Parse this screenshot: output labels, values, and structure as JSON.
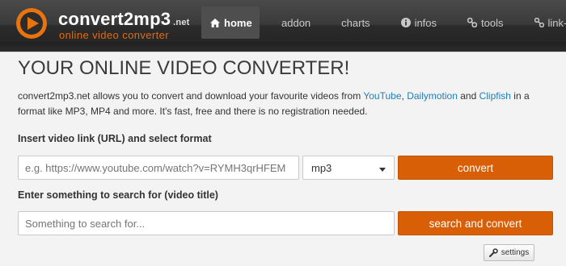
{
  "header": {
    "brand": "convert2mp3",
    "brand_suffix": ".net",
    "tagline": "online video converter",
    "nav": [
      {
        "label": "home",
        "icon": "home-icon"
      },
      {
        "label": "addon"
      },
      {
        "label": "charts"
      },
      {
        "label": "infos",
        "icon": "info-icon"
      },
      {
        "label": "tools",
        "icon": "tools-icon"
      },
      {
        "label": "link-us",
        "icon": "link-icon"
      }
    ]
  },
  "main": {
    "title": "YOUR ONLINE VIDEO CONVERTER!",
    "intro": {
      "text1": "convert2mp3.net allows you to convert and download your favourite videos from ",
      "link1": "YouTube",
      "sep1": ", ",
      "link2": "Dailymotion",
      "sep2": " and ",
      "link3": "Clipfish",
      "text2": " in a format like MP3, MP4 and more. It's fast, free and there is no registration needed."
    },
    "url_label": "Insert video link (URL) and select format",
    "url_placeholder": "e.g. https://www.youtube.com/watch?v=RYMH3qrHFEM",
    "format_selected": "mp3",
    "convert_label": "convert",
    "search_label": "Enter something to search for (video title)",
    "search_placeholder": "Something to search for...",
    "search_convert_label": "search and convert",
    "settings_label": "settings"
  },
  "colors": {
    "accent": "#d85f05",
    "link": "#1f7fb8",
    "header_bg": "#2b2b2b"
  }
}
